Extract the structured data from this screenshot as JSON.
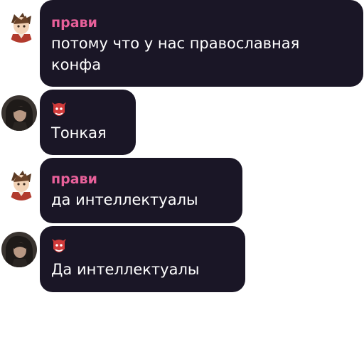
{
  "messages": [
    {
      "sender": "прави",
      "text": "потому что у нас православная\nконфа",
      "avatar_icon": "anime-boy-sticker-icon"
    },
    {
      "sender_icon": "red-mask-emoji-icon",
      "text": "Тонкая",
      "avatar_icon": "dark-hair-person-avatar-icon"
    },
    {
      "sender": "прави",
      "text": "да интеллектуалы",
      "avatar_icon": "anime-boy-sticker-icon"
    },
    {
      "sender_icon": "red-mask-emoji-icon",
      "text": "Да интеллектуалы",
      "avatar_icon": "dark-hair-person-avatar-icon"
    }
  ],
  "colors": {
    "bubble": "#1a1626",
    "sender_name": "#e8609a",
    "message_text": "#ffffff",
    "background": "#ffffff"
  }
}
